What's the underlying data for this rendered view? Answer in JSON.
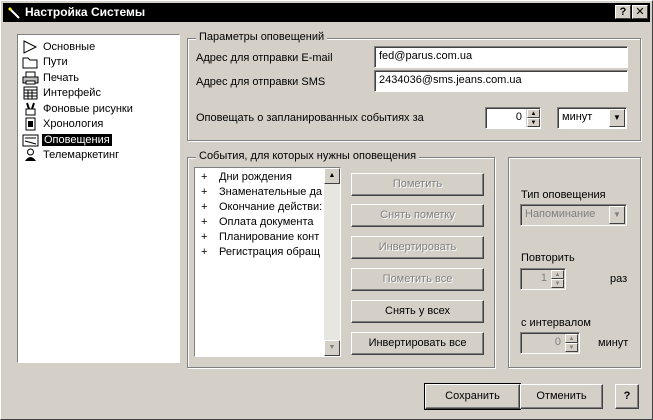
{
  "window": {
    "title": "Настройка Системы",
    "help_btn": "?",
    "close_btn": "✕"
  },
  "tree": {
    "items": [
      {
        "label": "Основные",
        "icon": "arrow-shape-icon"
      },
      {
        "label": "Пути",
        "icon": "folder-icon"
      },
      {
        "label": "Печать",
        "icon": "printer-icon"
      },
      {
        "label": "Интерфейс",
        "icon": "calendar-grid-icon"
      },
      {
        "label": "Фоновые рисунки",
        "icon": "paint-brushes-icon"
      },
      {
        "label": "Хронология",
        "icon": "document-icon"
      },
      {
        "label": "Оповещения",
        "icon": "notification-panel-icon",
        "selected": true
      },
      {
        "label": "Телемаркетинг",
        "icon": "person-icon"
      }
    ]
  },
  "params": {
    "group_label": "Параметры оповещений",
    "email_label": "Адрес для отправки E-mail",
    "email_value": "fed@parus.com.ua",
    "sms_label": "Адрес для отправки SMS",
    "sms_value": "2434036@sms.jeans.com.ua",
    "notify_label": "Оповещать о запланированных событиях за",
    "notify_value": "0",
    "notify_unit": "минут"
  },
  "events": {
    "group_label": "События, для которых нужны оповещения",
    "items": [
      "Дни рождения",
      "Знаменательные да",
      "Окончание действи:",
      "Оплата документа",
      "Планирование конт",
      "Регистрация обращ"
    ],
    "buttons": {
      "mark": "Пометить",
      "unmark": "Снять пометку",
      "invert": "Инвертировать",
      "mark_all": "Пометить все",
      "unmark_all": "Снять у всех",
      "invert_all": "Инвертировать все"
    }
  },
  "notify_type": {
    "type_label": "Тип оповещения",
    "type_value": "Напоминание",
    "repeat_label": "Повторить",
    "repeat_value": "1",
    "repeat_unit": "раз",
    "interval_label": "с интервалом",
    "interval_value": "0",
    "interval_unit": "минут"
  },
  "footer": {
    "save": "Сохранить",
    "cancel": "Отменить",
    "help": "?"
  },
  "colors": {
    "face": "#d4d0c8",
    "titlebar": "#000000",
    "disabled_text": "#808080"
  }
}
